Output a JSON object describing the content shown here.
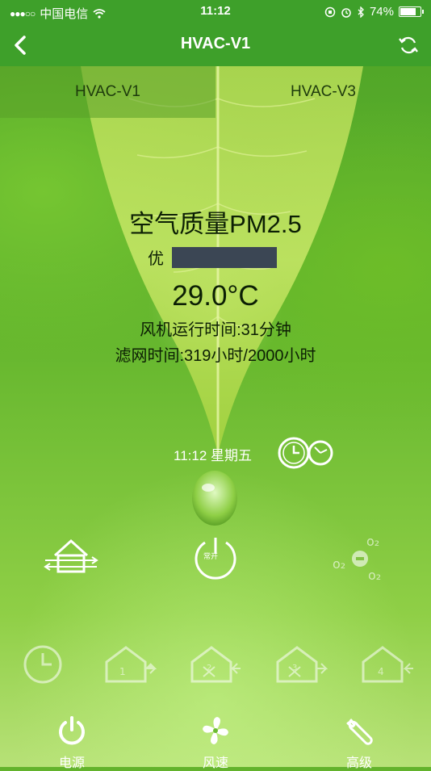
{
  "status_bar": {
    "carrier": "中国电信",
    "time": "11:12",
    "battery": "74%",
    "battery_level": 0.74
  },
  "nav": {
    "title": "HVAC-V1",
    "back_icon": "back-arrow-icon",
    "refresh_icon": "refresh-icon"
  },
  "device_tabs": [
    {
      "label": "HVAC-V1",
      "active": true
    },
    {
      "label": "HVAC-V3",
      "active": false
    }
  ],
  "air": {
    "pm_title": "空气质量PM2.5",
    "quality": "优",
    "temperature": "29.0°C",
    "fan_runtime": "风机运行时间:31分钟",
    "filter_time": "滤网时间:319小时/2000小时"
  },
  "datetime": "11:12 星期五",
  "mode_power_label": "常开",
  "bottom_tabs": [
    {
      "label": "电源",
      "icon": "power-icon"
    },
    {
      "label": "风速",
      "icon": "fan-icon"
    },
    {
      "label": "高级",
      "icon": "wrench-icon"
    }
  ],
  "colors": {
    "nav_bg": "#3ea02a",
    "pm_bar": "#3b4654"
  }
}
